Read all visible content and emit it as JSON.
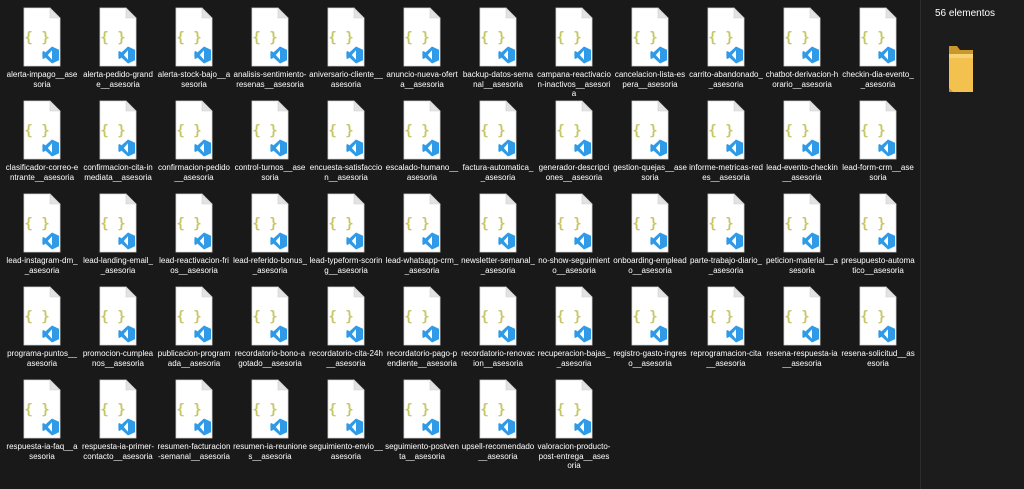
{
  "details_pane": {
    "item_count": "56 elementos",
    "preview_icon": "folder-icon"
  },
  "file_icon": {
    "glyph": "{ }",
    "glyph_color": "#c7c76a",
    "badge_icon": "vscode-icon",
    "badge_color": "#2f9be8",
    "page_color": "#ffffff"
  },
  "files": [
    "alerta-impago__asesoria",
    "alerta-pedido-grande__asesoria",
    "alerta-stock-bajo__asesoria",
    "analisis-sentimiento-resenas__asesoria",
    "aniversario-cliente__asesoria",
    "anuncio-nueva-oferta__asesoria",
    "backup-datos-semanal__asesoria",
    "campana-reactivacion-inactivos__asesoria",
    "cancelacion-lista-espera__asesoria",
    "carrito-abandonado__asesoria",
    "chatbot-derivacion-horario__asesoria",
    "checkin-dia-evento__asesoria",
    "clasificador-correo-entrante__asesoria",
    "confirmacion-cita-inmediata__asesoria",
    "confirmacion-pedido__asesoria",
    "control-turnos__asesoria",
    "encuesta-satisfaccion__asesoria",
    "escalado-humano__asesoria",
    "factura-automatica__asesoria",
    "generador-descripciones__asesoria",
    "gestion-quejas__asesoria",
    "informe-metricas-redes__asesoria",
    "lead-evento-checkin__asesoria",
    "lead-form-crm__asesoria",
    "lead-instagram-dm__asesoria",
    "lead-landing-email__asesoria",
    "lead-reactivacion-frios__asesoria",
    "lead-referido-bonus__asesoria",
    "lead-typeform-scoring__asesoria",
    "lead-whatsapp-crm__asesoria",
    "newsletter-semanal__asesoria",
    "no-show-seguimiento__asesoria",
    "onboarding-empleado__asesoria",
    "parte-trabajo-diario__asesoria",
    "peticion-material__asesoria",
    "presupuesto-automatico__asesoria",
    "programa-puntos__asesoria",
    "promocion-cumpleanos__asesoria",
    "publicacion-programada__asesoria",
    "recordatorio-bono-agotado__asesoria",
    "recordatorio-cita-24h__asesoria",
    "recordatorio-pago-pendiente__asesoria",
    "recordatorio-renovacion__asesoria",
    "recuperacion-bajas__asesoria",
    "registro-gasto-ingreso__asesoria",
    "reprogramacion-cita__asesoria",
    "resena-respuesta-ia__asesoria",
    "resena-solicitud__asesoria",
    "respuesta-ia-faq__asesoria",
    "respuesta-ia-primer-contacto__asesoria",
    "resumen-facturacion-semanal__asesoria",
    "resumen-ia-reuniones__asesoria",
    "seguimiento-envio__asesoria",
    "seguimiento-postventa__asesoria",
    "upsell-recomendado__asesoria",
    "valoracion-producto-post-entrega__asesoria"
  ]
}
